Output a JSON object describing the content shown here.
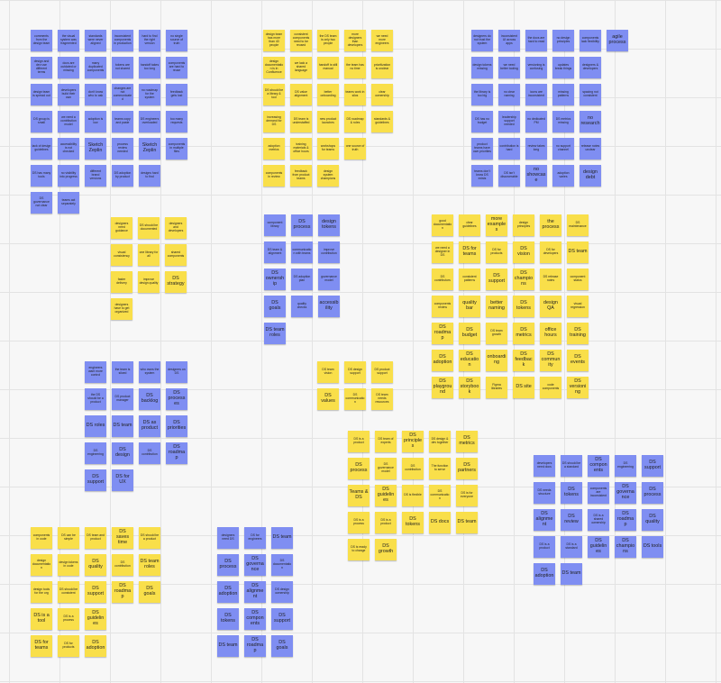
{
  "board": {
    "title": "",
    "colors": {
      "blue": "#7f8ef2",
      "yellow": "#f9df4a",
      "background": "#f7f7f7",
      "grid": "#e3e3e3"
    }
  },
  "clusters": [
    {
      "name": "cluster-blue-top-left",
      "color": "blue",
      "notes": [
        "comments from the design team",
        "the visual system was fragmented",
        "standards were never aligned",
        "inconsistent components in production",
        "hard to find the right version",
        "no single source of truth",
        "design and dev use different terms",
        "docs are outdated or missing",
        "many duplicated components",
        "tokens are not shared",
        "handoff takes too long",
        "components are hard to reuse",
        "design team is spread out",
        "developers build their own",
        "don't know who to ask",
        "changes are not communicated",
        "no roadmap for the system",
        "feedback gets lost",
        "DS group is small",
        "we need a contribution model",
        "adoption is low",
        "teams copy and paste",
        "DS engineers overloaded",
        "too many requests",
        "lack of design guidelines",
        "accessibility is not checked",
        "Sketch Zeplin",
        "process review needed",
        "Sketch Zeplin",
        "components in multiple files",
        "DS has many tools",
        "no visibility into progress",
        "different brand versions",
        "DS adoption by product",
        "designs hard to find",
        "",
        "DS governance not clear",
        "teams act separately"
      ]
    },
    {
      "name": "cluster-yellow-top-center",
      "color": "yellow",
      "notes": [
        "design team has more than 40 people",
        "consistent components need to be reused",
        "the DS team is only two people",
        "more designers than developers",
        "we need more engineers",
        "",
        "design documentation is in Confluence",
        "we lack a shared language",
        "handoff is still manual",
        "the team has no time",
        "prioritization is unclear",
        "",
        "DS should be a library & tool",
        "DS value alignment",
        "better onboarding",
        "teams work in silos",
        "clear ownership",
        "",
        "increasing demand for DS",
        "DS team is understaffed",
        "new product launches",
        "DS roadmap & roles",
        "standards & guidelines",
        "",
        "adoption metrics",
        "training materials & office hours",
        "workshops for teams",
        "one source of truth",
        "",
        "",
        "components in review",
        "feedback from product teams",
        "design system champions",
        "",
        "",
        ""
      ]
    },
    {
      "name": "cluster-blue-top-right",
      "color": "blue",
      "notes": [
        "designers do not trust the system",
        "inconsistent UI across apps",
        "the docs are hard to read",
        "no design principles",
        "components lack flexibility",
        "agile process",
        "design tokens missing",
        "we need better tooling",
        "versioning is confusing",
        "updates break things",
        "designers & developers",
        "",
        "the library is too big",
        "no clear naming",
        "icons are inconsistent",
        "missing patterns",
        "spacing not consistent",
        "",
        "DS has no budget",
        "leadership support needed",
        "no dedicated PM",
        "DS metrics missing",
        "no research",
        "",
        "product teams have own priorities",
        "contribution is hard",
        "review takes long",
        "no support channel",
        "release notes unclear",
        "",
        "teams don't know DS exists",
        "DS isn't discoverable",
        "no showcase",
        "adoption varies",
        "design debt",
        ""
      ]
    },
    {
      "name": "cluster-yellow-mid-left",
      "color": "yellow",
      "notes": [
        "designers need guidance",
        "DS should be documented",
        "designers and developers",
        "",
        "",
        "",
        "visual consistency",
        "one library for all",
        "shared components",
        "",
        "",
        "",
        "faster delivery",
        "improve design quality",
        "DS strategy",
        "",
        "",
        "",
        "designers have to get organized",
        "",
        "",
        "",
        "",
        ""
      ]
    },
    {
      "name": "cluster-blue-mid-center",
      "color": "blue",
      "notes": [
        "component library",
        "DS process",
        "design tokens",
        "",
        "",
        "",
        "DS team & alignment",
        "communication with teams",
        "improve contribution",
        "",
        "",
        "",
        "DS ownership",
        "DS adoption plan",
        "governance model",
        "",
        "",
        "",
        "DS goals",
        "quality checks",
        "accessibility",
        "",
        "",
        "",
        "DS team roles",
        "",
        "",
        "",
        "",
        ""
      ]
    },
    {
      "name": "cluster-yellow-mid-right",
      "color": "yellow",
      "notes": [
        "good documentation",
        "clear guidelines",
        "more examples",
        "design principles",
        "the process",
        "DS maintenance",
        "",
        "we need a designer in DS",
        "DS for teams",
        "DS for products",
        "DS vision",
        "DS for developers",
        "DS team",
        "",
        "DS contributors",
        "consistent patterns",
        "DS support",
        "DS champions",
        "DS release notes",
        "component status",
        "",
        "components review",
        "quality bar",
        "better naming",
        "DS tokens",
        "design QA",
        "visual regression",
        "",
        "DS roadmap",
        "DS budget",
        "DS team growth",
        "DS metrics",
        "office hours",
        "DS training",
        "",
        "DS adoption",
        "DS education",
        "onboarding",
        "DS feedback",
        "DS community",
        "DS events",
        "",
        "DS playground",
        "DS storybook",
        "Figma libraries",
        "DS site",
        "code components",
        "DS versioning",
        ""
      ]
    },
    {
      "name": "cluster-yellow-center-small",
      "color": "yellow",
      "notes": [
        "DS team vision",
        "DS design support",
        "DS product support",
        "DS values",
        "DS communication",
        "DS team needs resources"
      ]
    },
    {
      "name": "cluster-blue-left-middle",
      "color": "blue",
      "notes": [
        "engineers want more control",
        "the team is siloed",
        "who owns the system",
        "designers on DS",
        "",
        "the DS should be a product",
        "DS product manager",
        "DS backlog",
        "DS processes",
        "",
        "DS roles",
        "DS team",
        "DS as product",
        "DS priorities",
        "",
        "DS engineering",
        "DS design",
        "DS contribution",
        "DS roadmap",
        "",
        "DS support",
        "DS for UX",
        "",
        "",
        ""
      ]
    },
    {
      "name": "cluster-yellow-bottom-center",
      "color": "yellow",
      "notes": [
        "DS is a product",
        "DS team of experts",
        "DS principles",
        "DS design & dev together",
        "DS metrics",
        "DS process",
        "DS governance model",
        "DS contribution",
        "The function to serve",
        "DS partners",
        "Teams & DS",
        "DS guidelines",
        "DS is flexible",
        "DS communication",
        "DS is for everyone",
        "DS is a process",
        "DS is a product",
        "DS tokens",
        "DS docs",
        "DS team",
        "DS is ready to change",
        "DS growth",
        "",
        "",
        ""
      ]
    },
    {
      "name": "cluster-blue-bottom-right",
      "color": "blue",
      "notes": [
        "developers need docs",
        "DS should be a standard",
        "DS components",
        "DS engineering",
        "DS support",
        "",
        "DS needs structure",
        "DS tokens",
        "components are inconsistent",
        "DS governance",
        "DS process",
        "",
        "DS alignment",
        "DS review",
        "DS is a shared ownership",
        "DS roadmap",
        "DS quality",
        "",
        "DS is a product",
        "DS is a standard",
        "DS guidelines",
        "DS champions",
        "DS tools",
        "",
        "DS adoption",
        "DS team",
        "",
        "",
        "",
        ""
      ]
    },
    {
      "name": "cluster-yellow-bottom-left",
      "color": "yellow",
      "notes": [
        "components in code",
        "DS can be simple",
        "DS team and product",
        "DS saves time",
        "DS should be a product",
        "",
        "design documentation",
        "design tokens in code",
        "DS quality",
        "DS contribution",
        "DS team roles",
        "",
        "design tools for the org",
        "DS should be consistent",
        "DS support",
        "DS roadmap",
        "DS goals",
        "",
        "DS is a tool",
        "DS is a process",
        "DS guidelines",
        "",
        "",
        "",
        "DS for teams",
        "DS for products",
        "DS adoption",
        "",
        "",
        ""
      ]
    },
    {
      "name": "cluster-blue-bottom-center-left",
      "color": "blue",
      "notes": [
        "designers need DS",
        "DS for engineers",
        "DS team",
        "",
        "DS process",
        "DS governance",
        "DS documentation",
        "",
        "DS adoption",
        "DS alignment",
        "DS design ownership",
        "",
        "DS tokens",
        "DS components",
        "DS support",
        "",
        "DS team",
        "DS roadmap",
        "DS goals",
        ""
      ]
    }
  ]
}
